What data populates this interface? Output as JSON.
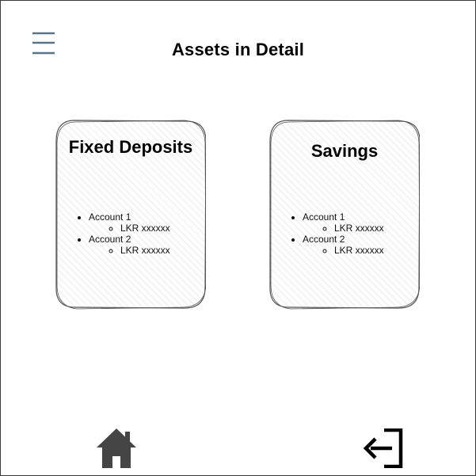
{
  "header": {
    "title": "Assets in Detail",
    "menu_icon": "hamburger-menu-icon"
  },
  "cards": [
    {
      "title": "Fixed Deposits",
      "accounts": [
        {
          "name": "Account 1",
          "balance": "LKR xxxxxx"
        },
        {
          "name": "Account 2",
          "balance": "LKR xxxxxx"
        }
      ]
    },
    {
      "title": "Savings",
      "accounts": [
        {
          "name": "Account 1",
          "balance": "LKR xxxxxx"
        },
        {
          "name": "Account 2",
          "balance": "LKR xxxxxx"
        }
      ]
    }
  ],
  "footer": {
    "home_icon": "home-icon",
    "logout_icon": "logout-icon"
  },
  "colors": {
    "menu_icon": "#5b7387",
    "icon_dark": "#454545",
    "card_border": "#555555",
    "hatch": "#d9d9d9"
  }
}
